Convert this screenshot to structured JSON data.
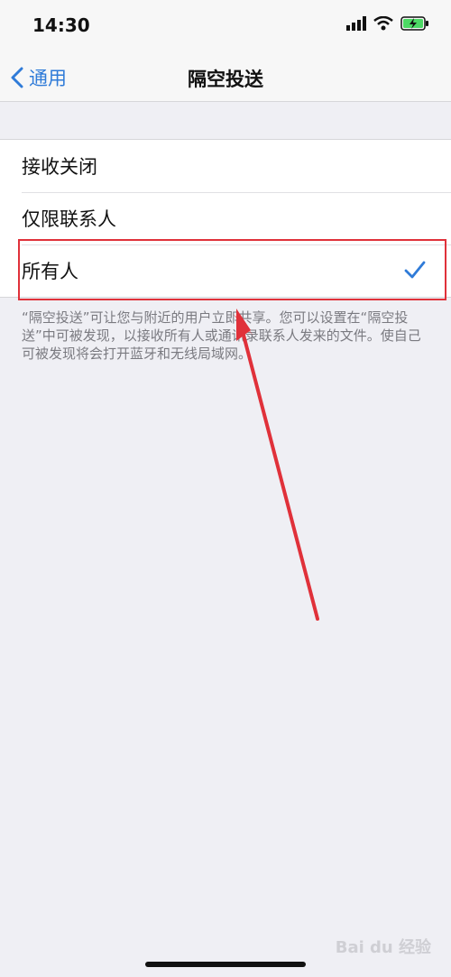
{
  "status_bar": {
    "time": "14:30"
  },
  "nav": {
    "back_label": "通用",
    "title": "隔空投送"
  },
  "options": [
    {
      "label": "接收关闭",
      "selected": false
    },
    {
      "label": "仅限联系人",
      "selected": false
    },
    {
      "label": "所有人",
      "selected": true
    }
  ],
  "footer": "“隔空投送”可让您与附近的用户立即共享。您可以设置在“隔空投送”中可被发现，以接收所有人或通讯录联系人发来的文件。使自己可被发现将会打开蓝牙和无线局域网。",
  "watermark": "Bai du 经验",
  "colors": {
    "accent": "#2f7bd8",
    "annotation": "#e0313a",
    "background": "#efeff4"
  }
}
